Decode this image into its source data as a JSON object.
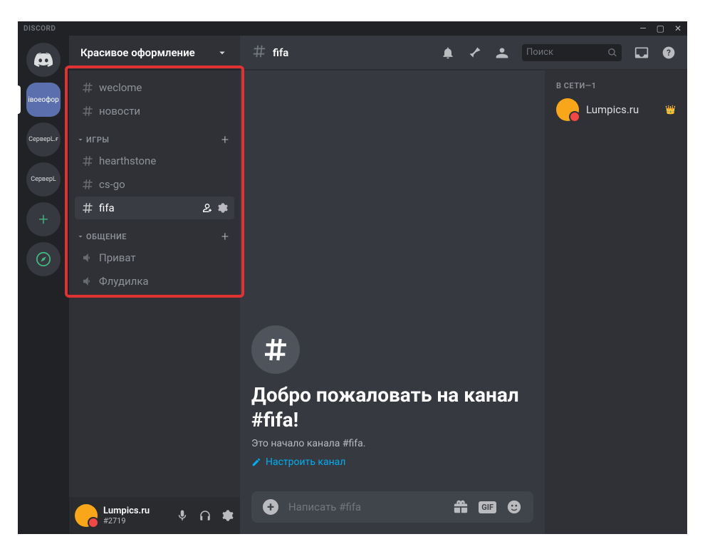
{
  "titlebar": {
    "brand": "DISCORD"
  },
  "server_header": {
    "name": "Красивое оформление"
  },
  "servers": {
    "active_tile_label": "івоеофор",
    "s2": "СерверL.ғ",
    "s3": "СерверL"
  },
  "channels": {
    "top": [
      {
        "name": "weclome"
      },
      {
        "name": "новости"
      }
    ],
    "cat_games": "ИГРЫ",
    "games": [
      {
        "name": "hearthstone"
      },
      {
        "name": "cs-go"
      },
      {
        "name": "fifa",
        "selected": true
      }
    ],
    "cat_chat": "ОБЩЕНИЕ",
    "voice": [
      {
        "name": "Приват"
      },
      {
        "name": "Флудилка"
      }
    ]
  },
  "user": {
    "name": "Lumpics.ru",
    "tag": "#2719"
  },
  "header": {
    "channel": "fifa",
    "search": "Поиск"
  },
  "welcome": {
    "title_line1": "Добро пожаловать на канал",
    "title_line2": "#fifa!",
    "subtitle": "Это начало канала #fifa.",
    "action": "Настроить канал"
  },
  "input": {
    "placeholder": "Написать #fifa",
    "gif": "GIF"
  },
  "members": {
    "header": "В СЕТИ—1",
    "list": [
      {
        "name": "Lumpics.ru"
      }
    ]
  }
}
